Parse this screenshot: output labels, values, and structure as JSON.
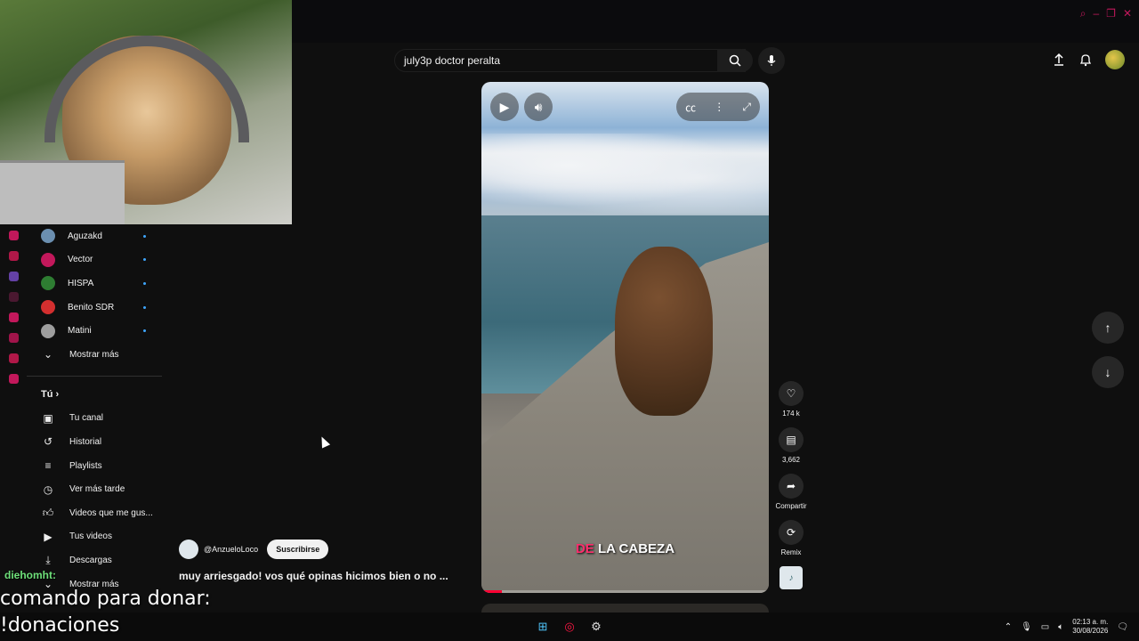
{
  "search": {
    "value": "july3p doctor peralta"
  },
  "sidebar": {
    "subscriptions": [
      {
        "name": "Aguzakd",
        "color": "#6b8fb0"
      },
      {
        "name": "Vector",
        "color": "#c2185b"
      },
      {
        "name": "HISPA",
        "color": "#2e7d32"
      },
      {
        "name": "Benito SDR",
        "color": "#d32f2f"
      },
      {
        "name": "Matini",
        "color": "#9e9e9e"
      }
    ],
    "show_more_label": "Mostrar más",
    "you_section": "Tú",
    "you_items": [
      {
        "label": "Tu canal",
        "icon": "channel-icon"
      },
      {
        "label": "Historial",
        "icon": "history-icon"
      },
      {
        "label": "Playlists",
        "icon": "playlists-icon"
      },
      {
        "label": "Ver más tarde",
        "icon": "watch-later-icon"
      },
      {
        "label": "Videos que me gus...",
        "icon": "like-icon"
      },
      {
        "label": "Tus videos",
        "icon": "your-videos-icon"
      },
      {
        "label": "Descargas",
        "icon": "download-icon"
      },
      {
        "label": "Mostrar más",
        "icon": "chevron-down-icon"
      }
    ]
  },
  "player": {
    "subtitle_highlight": "DE",
    "subtitle_rest": " LA CABEZA",
    "progress_fraction": 0.07
  },
  "actions": {
    "likes": "174 k",
    "comments": "3,662",
    "share_label": "Compartir",
    "remix_label": "Remix"
  },
  "video": {
    "channel": "@AnzueloLoco",
    "subscribe_label": "Suscribirse",
    "title": "muy arriesgado! vos qué opinas hicimos bien o no ..."
  },
  "stream_overlay": {
    "chat_user": "diehomht:",
    "line1": "comando para donar:",
    "line2": "!donaciones"
  },
  "taskbar": {
    "time": "02:13 a. m.",
    "date": "30/08/2026"
  },
  "colors": {
    "accent": "#ff0033",
    "subtitle_highlight": "#ff2e6d",
    "chat_user": "#6ee07a"
  }
}
